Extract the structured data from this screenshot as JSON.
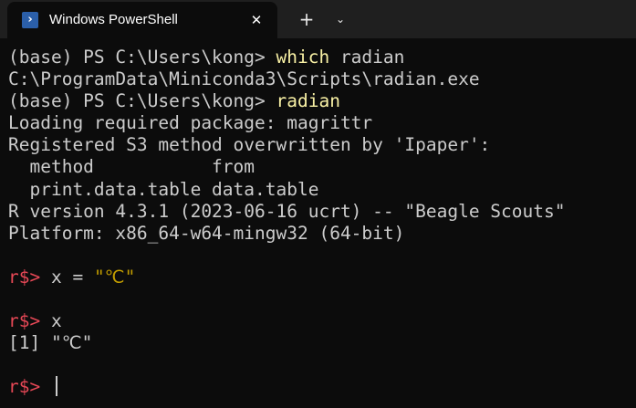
{
  "window": {
    "tab_title": "Windows PowerShell",
    "tab_icon": "powershell-icon",
    "close_icon": "close-icon",
    "new_tab_label": "+",
    "dropdown_icon": "chevron-down-icon",
    "colors": {
      "titlebar": "#1f1f1f",
      "background": "#0c0c0c",
      "text": "#cccccc",
      "command": "#f9f1a5",
      "r_prompt": "#e74856",
      "string": "#c19c00"
    }
  },
  "terminal": {
    "l1_prompt": "(base) PS C:\\Users\\kong> ",
    "l1_cmd": "which",
    "l1_rest": " radian",
    "l2": "C:\\ProgramData\\Miniconda3\\Scripts\\radian.exe",
    "l3_prompt": "(base) PS C:\\Users\\kong> ",
    "l3_cmd": "radian",
    "l4": "Loading required package: magrittr",
    "l5": "Registered S3 method overwritten by 'Ipaper':",
    "l6": "  method           from",
    "l7": "  print.data.table data.table",
    "l8": "R version 4.3.1 (2023-06-16 ucrt) -- \"Beagle Scouts\"",
    "l9": "Platform: x86_64-w64-mingw32 (64-bit)",
    "r_prompt": "r$>",
    "l11_code": " x = ",
    "l11_str": "\"℃\"",
    "l13_code": " x",
    "l14": "[1] \"℃\"",
    "l16_code": " "
  }
}
